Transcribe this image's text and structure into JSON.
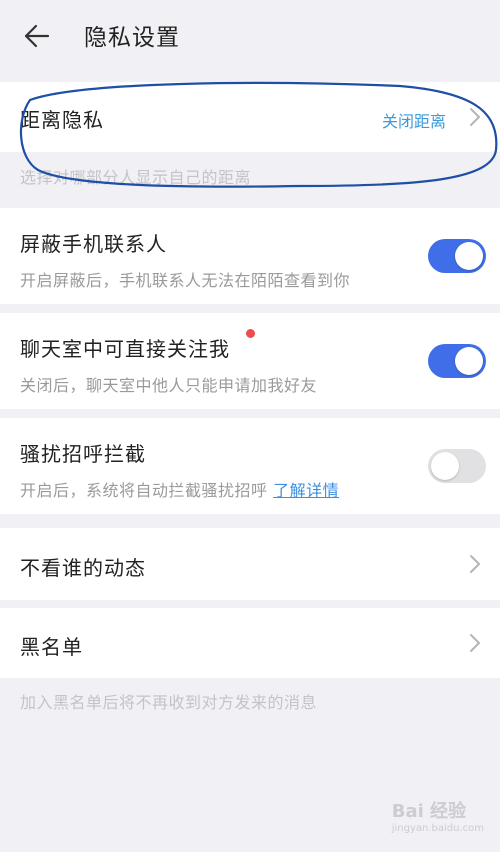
{
  "header": {
    "title": "隐私设置"
  },
  "distance": {
    "label": "距离隐私",
    "value": "关闭距离",
    "note": "选择对哪部分人显示自己的距离"
  },
  "block_contacts": {
    "label": "屏蔽手机联系人",
    "desc": "开启屏蔽后，手机联系人无法在陌陌查看到你",
    "on": true
  },
  "chatroom_follow": {
    "label": "聊天室中可直接关注我",
    "desc": "关闭后，聊天室中他人只能申请加我好友",
    "on": true
  },
  "harass_block": {
    "label": "骚扰招呼拦截",
    "desc": "开启后，系统将自动拦截骚扰招呼",
    "link": "了解详情",
    "on": false
  },
  "hide_feeds": {
    "label": "不看谁的动态"
  },
  "blacklist": {
    "label": "黑名单",
    "note": "加入黑名单后将不再收到对方发来的消息"
  },
  "watermark": {
    "brand": "Bai 经验",
    "url": "jingyan.baidu.com"
  },
  "colors": {
    "toggle_on": "#3f6ee8",
    "accent": "#3b9ad9",
    "dot": "#ee4d4d",
    "annotation": "#1f4ea6"
  }
}
